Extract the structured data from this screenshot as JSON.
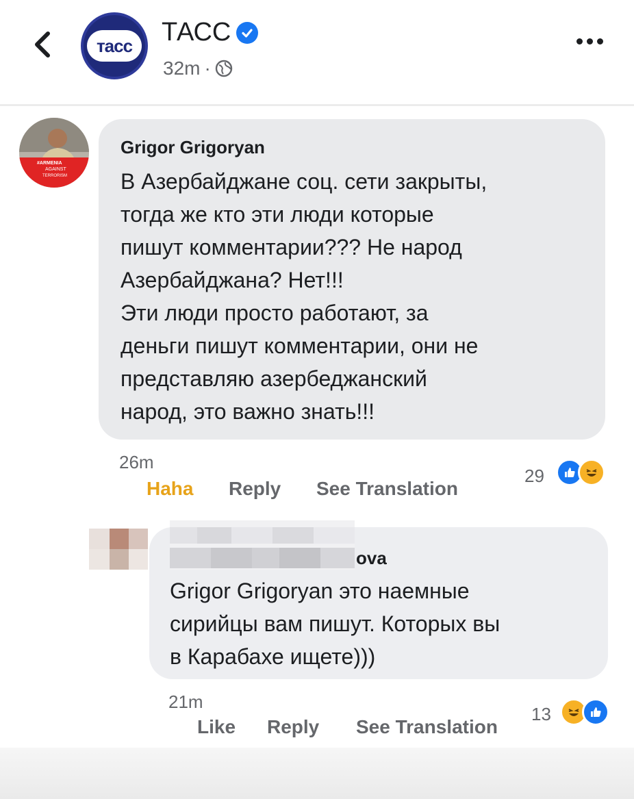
{
  "header": {
    "page_name": "ТАСС",
    "logo_text": "тасс",
    "time": "32m",
    "separator": "·"
  },
  "comments": [
    {
      "author": "Grigor Grigoryan",
      "avatar_badge": [
        "#ARMENIA",
        "AGAINST",
        "TERRORISM"
      ],
      "text": "В Азербайджане соц. сети закрыты,\nтогда же кто эти люди которые\nпишут комментарии??? Не народ\nАзербайджана? Нет!!!\nЭти люди просто работают, за\nденьги пишут комментарии, они не\nпредставляю азербеджанский\nнарод, это важно знать!!!",
      "time": "26m",
      "actions": {
        "reaction": "Haha",
        "reply": "Reply",
        "translate": "See Translation"
      },
      "reaction_count": "29",
      "reactions": [
        "like",
        "haha"
      ]
    },
    {
      "author": "ova",
      "text": "Grigor Grigoryan это наемные\nсирийцы вам пишут. Которых вы\nв Карабахе ищете)))",
      "time": "21m",
      "actions": {
        "like": "Like",
        "reply": "Reply",
        "translate": "See Translation"
      },
      "reaction_count": "13",
      "reactions": [
        "haha",
        "like"
      ]
    }
  ],
  "colors": {
    "haha_active": "#e7a31a",
    "verified": "#1877f2",
    "bubble": "#e9eaec",
    "secondary_text": "#65676b"
  }
}
